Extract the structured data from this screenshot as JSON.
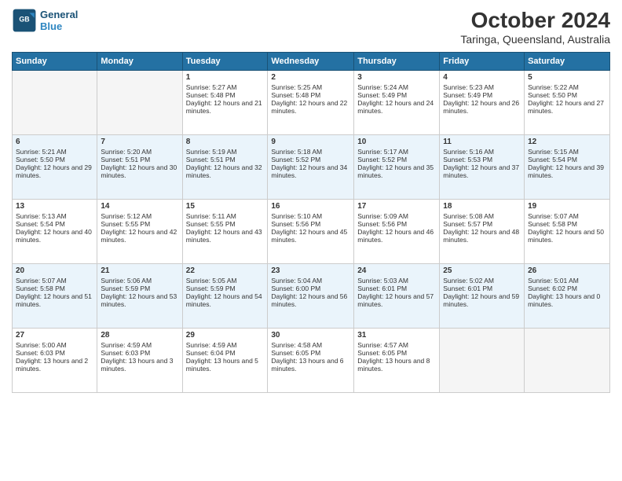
{
  "header": {
    "logo_line1": "General",
    "logo_line2": "Blue",
    "month": "October 2024",
    "location": "Taringa, Queensland, Australia"
  },
  "days_of_week": [
    "Sunday",
    "Monday",
    "Tuesday",
    "Wednesday",
    "Thursday",
    "Friday",
    "Saturday"
  ],
  "weeks": [
    [
      {
        "day": "",
        "empty": true
      },
      {
        "day": "",
        "empty": true
      },
      {
        "day": "1",
        "sunrise": "Sunrise: 5:27 AM",
        "sunset": "Sunset: 5:48 PM",
        "daylight": "Daylight: 12 hours and 21 minutes."
      },
      {
        "day": "2",
        "sunrise": "Sunrise: 5:25 AM",
        "sunset": "Sunset: 5:48 PM",
        "daylight": "Daylight: 12 hours and 22 minutes."
      },
      {
        "day": "3",
        "sunrise": "Sunrise: 5:24 AM",
        "sunset": "Sunset: 5:49 PM",
        "daylight": "Daylight: 12 hours and 24 minutes."
      },
      {
        "day": "4",
        "sunrise": "Sunrise: 5:23 AM",
        "sunset": "Sunset: 5:49 PM",
        "daylight": "Daylight: 12 hours and 26 minutes."
      },
      {
        "day": "5",
        "sunrise": "Sunrise: 5:22 AM",
        "sunset": "Sunset: 5:50 PM",
        "daylight": "Daylight: 12 hours and 27 minutes."
      }
    ],
    [
      {
        "day": "6",
        "sunrise": "Sunrise: 5:21 AM",
        "sunset": "Sunset: 5:50 PM",
        "daylight": "Daylight: 12 hours and 29 minutes."
      },
      {
        "day": "7",
        "sunrise": "Sunrise: 5:20 AM",
        "sunset": "Sunset: 5:51 PM",
        "daylight": "Daylight: 12 hours and 30 minutes."
      },
      {
        "day": "8",
        "sunrise": "Sunrise: 5:19 AM",
        "sunset": "Sunset: 5:51 PM",
        "daylight": "Daylight: 12 hours and 32 minutes."
      },
      {
        "day": "9",
        "sunrise": "Sunrise: 5:18 AM",
        "sunset": "Sunset: 5:52 PM",
        "daylight": "Daylight: 12 hours and 34 minutes."
      },
      {
        "day": "10",
        "sunrise": "Sunrise: 5:17 AM",
        "sunset": "Sunset: 5:52 PM",
        "daylight": "Daylight: 12 hours and 35 minutes."
      },
      {
        "day": "11",
        "sunrise": "Sunrise: 5:16 AM",
        "sunset": "Sunset: 5:53 PM",
        "daylight": "Daylight: 12 hours and 37 minutes."
      },
      {
        "day": "12",
        "sunrise": "Sunrise: 5:15 AM",
        "sunset": "Sunset: 5:54 PM",
        "daylight": "Daylight: 12 hours and 39 minutes."
      }
    ],
    [
      {
        "day": "13",
        "sunrise": "Sunrise: 5:13 AM",
        "sunset": "Sunset: 5:54 PM",
        "daylight": "Daylight: 12 hours and 40 minutes."
      },
      {
        "day": "14",
        "sunrise": "Sunrise: 5:12 AM",
        "sunset": "Sunset: 5:55 PM",
        "daylight": "Daylight: 12 hours and 42 minutes."
      },
      {
        "day": "15",
        "sunrise": "Sunrise: 5:11 AM",
        "sunset": "Sunset: 5:55 PM",
        "daylight": "Daylight: 12 hours and 43 minutes."
      },
      {
        "day": "16",
        "sunrise": "Sunrise: 5:10 AM",
        "sunset": "Sunset: 5:56 PM",
        "daylight": "Daylight: 12 hours and 45 minutes."
      },
      {
        "day": "17",
        "sunrise": "Sunrise: 5:09 AM",
        "sunset": "Sunset: 5:56 PM",
        "daylight": "Daylight: 12 hours and 46 minutes."
      },
      {
        "day": "18",
        "sunrise": "Sunrise: 5:08 AM",
        "sunset": "Sunset: 5:57 PM",
        "daylight": "Daylight: 12 hours and 48 minutes."
      },
      {
        "day": "19",
        "sunrise": "Sunrise: 5:07 AM",
        "sunset": "Sunset: 5:58 PM",
        "daylight": "Daylight: 12 hours and 50 minutes."
      }
    ],
    [
      {
        "day": "20",
        "sunrise": "Sunrise: 5:07 AM",
        "sunset": "Sunset: 5:58 PM",
        "daylight": "Daylight: 12 hours and 51 minutes."
      },
      {
        "day": "21",
        "sunrise": "Sunrise: 5:06 AM",
        "sunset": "Sunset: 5:59 PM",
        "daylight": "Daylight: 12 hours and 53 minutes."
      },
      {
        "day": "22",
        "sunrise": "Sunrise: 5:05 AM",
        "sunset": "Sunset: 5:59 PM",
        "daylight": "Daylight: 12 hours and 54 minutes."
      },
      {
        "day": "23",
        "sunrise": "Sunrise: 5:04 AM",
        "sunset": "Sunset: 6:00 PM",
        "daylight": "Daylight: 12 hours and 56 minutes."
      },
      {
        "day": "24",
        "sunrise": "Sunrise: 5:03 AM",
        "sunset": "Sunset: 6:01 PM",
        "daylight": "Daylight: 12 hours and 57 minutes."
      },
      {
        "day": "25",
        "sunrise": "Sunrise: 5:02 AM",
        "sunset": "Sunset: 6:01 PM",
        "daylight": "Daylight: 12 hours and 59 minutes."
      },
      {
        "day": "26",
        "sunrise": "Sunrise: 5:01 AM",
        "sunset": "Sunset: 6:02 PM",
        "daylight": "Daylight: 13 hours and 0 minutes."
      }
    ],
    [
      {
        "day": "27",
        "sunrise": "Sunrise: 5:00 AM",
        "sunset": "Sunset: 6:03 PM",
        "daylight": "Daylight: 13 hours and 2 minutes."
      },
      {
        "day": "28",
        "sunrise": "Sunrise: 4:59 AM",
        "sunset": "Sunset: 6:03 PM",
        "daylight": "Daylight: 13 hours and 3 minutes."
      },
      {
        "day": "29",
        "sunrise": "Sunrise: 4:59 AM",
        "sunset": "Sunset: 6:04 PM",
        "daylight": "Daylight: 13 hours and 5 minutes."
      },
      {
        "day": "30",
        "sunrise": "Sunrise: 4:58 AM",
        "sunset": "Sunset: 6:05 PM",
        "daylight": "Daylight: 13 hours and 6 minutes."
      },
      {
        "day": "31",
        "sunrise": "Sunrise: 4:57 AM",
        "sunset": "Sunset: 6:05 PM",
        "daylight": "Daylight: 13 hours and 8 minutes."
      },
      {
        "day": "",
        "empty": true
      },
      {
        "day": "",
        "empty": true
      }
    ]
  ]
}
